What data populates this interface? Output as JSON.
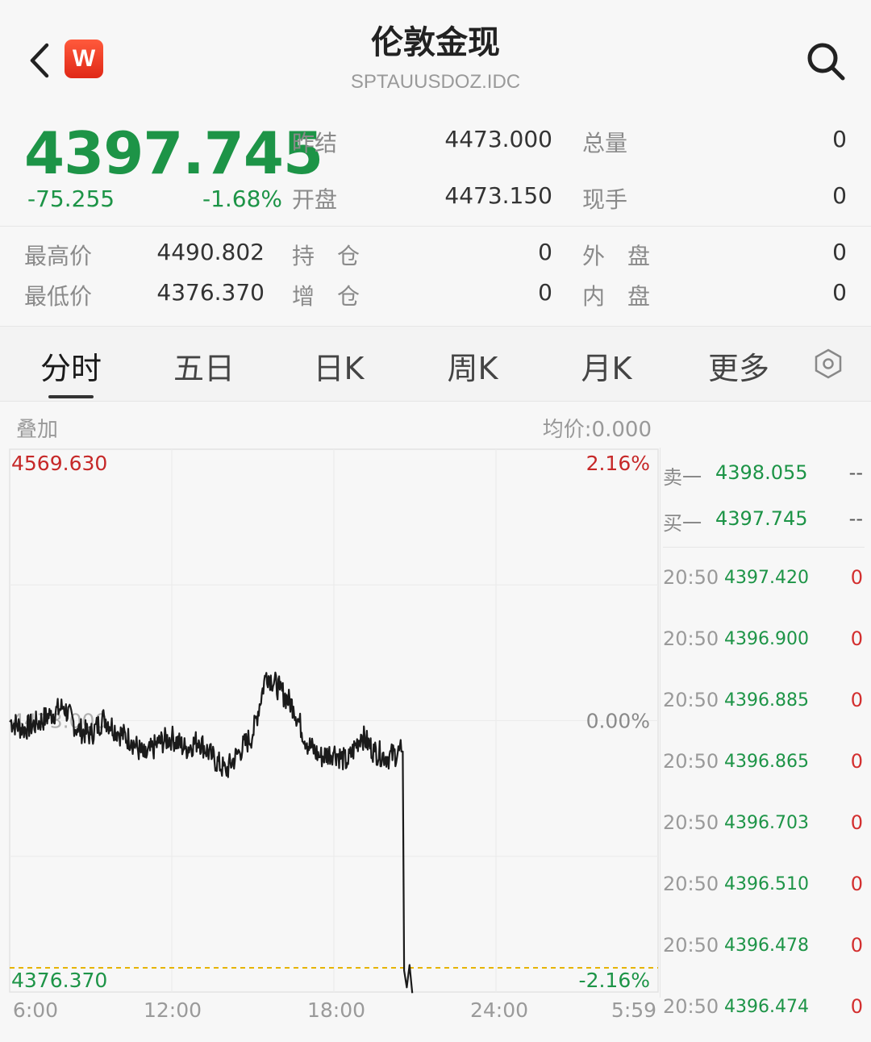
{
  "header": {
    "title": "伦敦金现",
    "symbol": "SPTAUUSDOZ.IDC",
    "logo_letter": "W",
    "back_icon": "back-arrow-icon",
    "search_icon": "search-icon"
  },
  "quote": {
    "price": "4397.745",
    "change": "-75.255",
    "change_pct": "-1.68%",
    "color_down": "#1d9447",
    "color_up": "#d32f2f"
  },
  "stats": [
    {
      "label": "昨结",
      "value": "4473.000"
    },
    {
      "label": "总量",
      "value": "0"
    },
    {
      "label": "开盘",
      "value": "4473.150"
    },
    {
      "label": "现手",
      "value": "0"
    },
    {
      "label": "最高价",
      "value": "4490.802"
    },
    {
      "label": "持　仓",
      "value": "0"
    },
    {
      "label": "外　盘",
      "value": "0"
    },
    {
      "label": "最低价",
      "value": "4376.370"
    },
    {
      "label": "增　仓",
      "value": "0"
    },
    {
      "label": "内　盘",
      "value": "0"
    }
  ],
  "tabs": [
    {
      "label": "分时",
      "active": true
    },
    {
      "label": "五日"
    },
    {
      "label": "日K"
    },
    {
      "label": "周K"
    },
    {
      "label": "月K"
    },
    {
      "label": "更多"
    }
  ],
  "chart_header": {
    "overlay": "叠加",
    "avg_price": "均价:0.000"
  },
  "chart_data": {
    "type": "line",
    "y_max_label": "4569.630",
    "y_mid_label": "4473.000",
    "y_min_label": "4376.370",
    "pct_max_label": "2.16%",
    "pct_mid_label": "0.00%",
    "pct_min_label": "-2.16%",
    "ylim": [
      4376.37,
      4569.63
    ],
    "reference": 4473.0,
    "avg_line": 4385.0,
    "x_tick_labels": [
      "6:00",
      "12:00",
      "18:00",
      "24:00",
      "5:59"
    ],
    "x_unit": "hours since 6:00",
    "xlim": [
      0,
      24
    ],
    "series": [
      {
        "x": [
          0,
          0.5,
          1,
          1.5,
          2,
          2.5,
          3,
          3.5,
          4,
          4.5,
          5,
          5.5,
          6,
          6.5,
          7,
          7.5,
          8,
          8.5,
          9,
          9.5,
          10,
          10.5,
          11,
          11.5,
          12,
          12.5,
          13,
          13.5,
          14,
          14.5,
          14.55,
          14.6,
          14.7,
          14.8,
          14.9
        ],
        "y": [
          4473,
          4470,
          4472,
          4475,
          4478,
          4470,
          4468,
          4474,
          4469,
          4466,
          4460,
          4465,
          4467,
          4463,
          4466,
          4460,
          4455,
          4462,
          4468,
          4490,
          4484,
          4478,
          4465,
          4460,
          4462,
          4458,
          4468,
          4462,
          4460,
          4462,
          4462,
          4384,
          4378,
          4386,
          4376
        ]
      }
    ]
  },
  "order_book": [
    {
      "label": "卖一",
      "price": "4398.055",
      "vol": "--"
    },
    {
      "label": "买一",
      "price": "4397.745",
      "vol": "--"
    }
  ],
  "ticks": [
    {
      "time": "20:50",
      "price": "4397.420",
      "vol": "0"
    },
    {
      "time": "20:50",
      "price": "4396.900",
      "vol": "0"
    },
    {
      "time": "20:50",
      "price": "4396.885",
      "vol": "0"
    },
    {
      "time": "20:50",
      "price": "4396.865",
      "vol": "0"
    },
    {
      "time": "20:50",
      "price": "4396.703",
      "vol": "0"
    },
    {
      "time": "20:50",
      "price": "4396.510",
      "vol": "0"
    },
    {
      "time": "20:50",
      "price": "4396.478",
      "vol": "0"
    },
    {
      "time": "20:50",
      "price": "4396.474",
      "vol": "0"
    }
  ]
}
